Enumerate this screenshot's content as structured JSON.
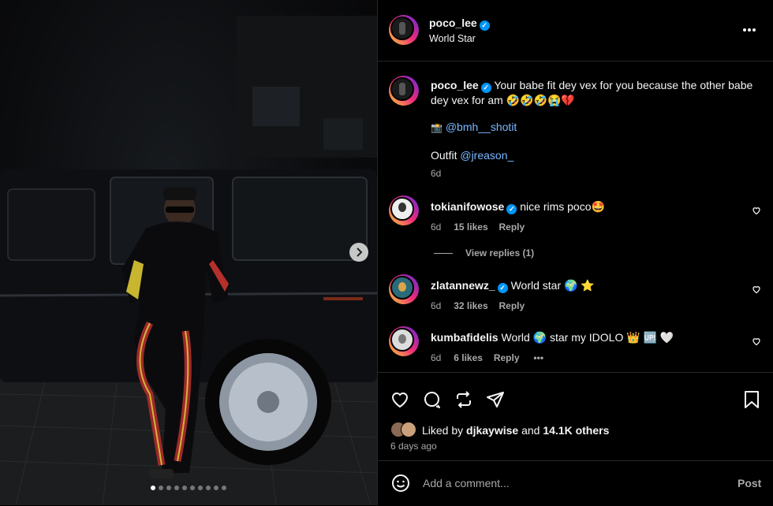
{
  "post": {
    "author": "poco_lee",
    "author_subtitle": "World Star",
    "more_icon": "more-horizontal-icon",
    "caption": {
      "text": "Your babe fit dey vex for you because the other babe dey vex for am 🤣🤣🤣😭💔",
      "credit_prefix": "📸",
      "credit_handle": "@bmh__shotit",
      "outfit_label": "Outfit",
      "outfit_handle": "@jreason_",
      "time": "6d"
    },
    "carousel": {
      "count": 10,
      "active_index": 0
    }
  },
  "comments": [
    {
      "username": "tokianifowose",
      "verified": true,
      "text": "nice rims poco🤩",
      "time": "6d",
      "likes": "15 likes",
      "reply_label": "Reply",
      "view_replies": "View replies (1)"
    },
    {
      "username": "zlatannewz_",
      "verified": true,
      "text": "World star 🌍 ⭐",
      "time": "6d",
      "likes": "32 likes",
      "reply_label": "Reply"
    },
    {
      "username": "kumbafidelis",
      "verified": false,
      "text": "World 🌍 star my IDOLO 👑 🆙 🤍",
      "time": "6d",
      "likes": "6 likes",
      "reply_label": "Reply",
      "more_label": "•••"
    }
  ],
  "likes_summary": {
    "prefix": "Liked by",
    "user": "djkaywise",
    "middle": "and",
    "others": "14.1K others",
    "date": "6 days ago"
  },
  "add_comment": {
    "placeholder": "Add a comment...",
    "post_label": "Post"
  },
  "colors": {
    "background": "#000000",
    "verified_blue": "#0095f6",
    "link_blue": "#7ab8ff",
    "muted": "#a8a8a8"
  }
}
